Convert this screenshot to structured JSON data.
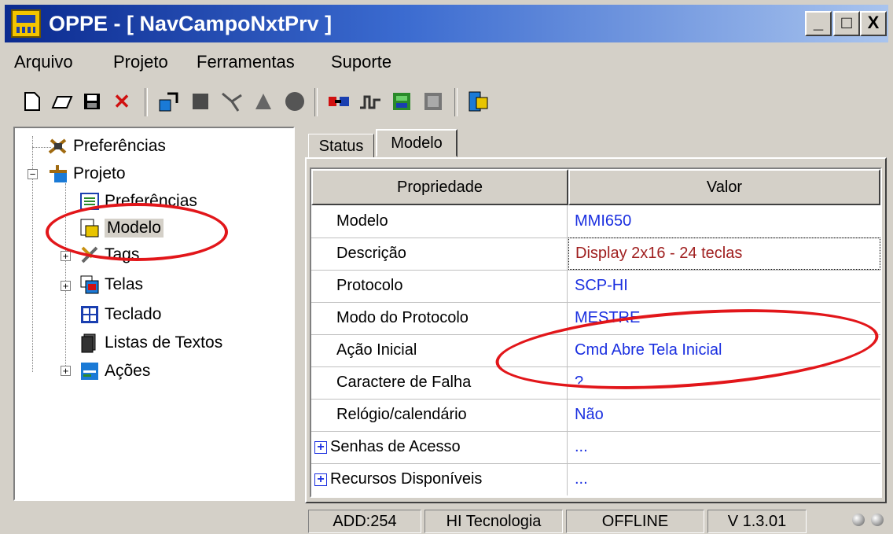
{
  "window": {
    "title": "OPPE - [ NavCampoNxtPrv ]",
    "controls": {
      "minimize": "_",
      "maximize": "□",
      "close": "X"
    }
  },
  "menu": {
    "items": [
      "Arquivo",
      "Projeto",
      "Ferramentas",
      "Suporte"
    ]
  },
  "toolbar": {
    "icons": [
      "new-icon",
      "open-icon",
      "save-icon",
      "delete-icon",
      "transfer-icon",
      "build-icon",
      "config-icon",
      "simulate-icon",
      "record-icon",
      "connect-icon",
      "disconnect-icon",
      "download-icon",
      "upload-icon",
      "exit-icon"
    ]
  },
  "tree": {
    "items": [
      {
        "label": "Preferências"
      },
      {
        "label": "Projeto"
      },
      {
        "label": "Preferências"
      },
      {
        "label": "Modelo"
      },
      {
        "label": "Tags"
      },
      {
        "label": "Telas"
      },
      {
        "label": "Teclado"
      },
      {
        "label": "Listas de Textos"
      },
      {
        "label": "Ações"
      }
    ]
  },
  "tabs": [
    "Status",
    "Modelo"
  ],
  "grid": {
    "headers": [
      "Propriedade",
      "Valor"
    ],
    "rows": [
      {
        "prop": "Modelo",
        "value": "MMI650"
      },
      {
        "prop": "Descrição",
        "value": "Display 2x16 - 24 teclas"
      },
      {
        "prop": "Protocolo",
        "value": "SCP-HI"
      },
      {
        "prop": "Modo do Protocolo",
        "value": "MESTRE"
      },
      {
        "prop": "Ação Inicial",
        "value": "Cmd Abre Tela Inicial"
      },
      {
        "prop": "Caractere de Falha",
        "value": "?"
      },
      {
        "prop": "Relógio/calendário",
        "value": "Não"
      },
      {
        "prop": "Senhas de Acesso",
        "value": "..."
      },
      {
        "prop": "Recursos Disponíveis",
        "value": "..."
      }
    ]
  },
  "status": {
    "address": "ADD:254",
    "company": "HI Tecnologia",
    "connection": "OFFLINE",
    "version": "V 1.3.01"
  },
  "colors": {
    "accent": "#1a2fe0",
    "focus_value": "#a02020",
    "annotation": "#e2161a"
  }
}
